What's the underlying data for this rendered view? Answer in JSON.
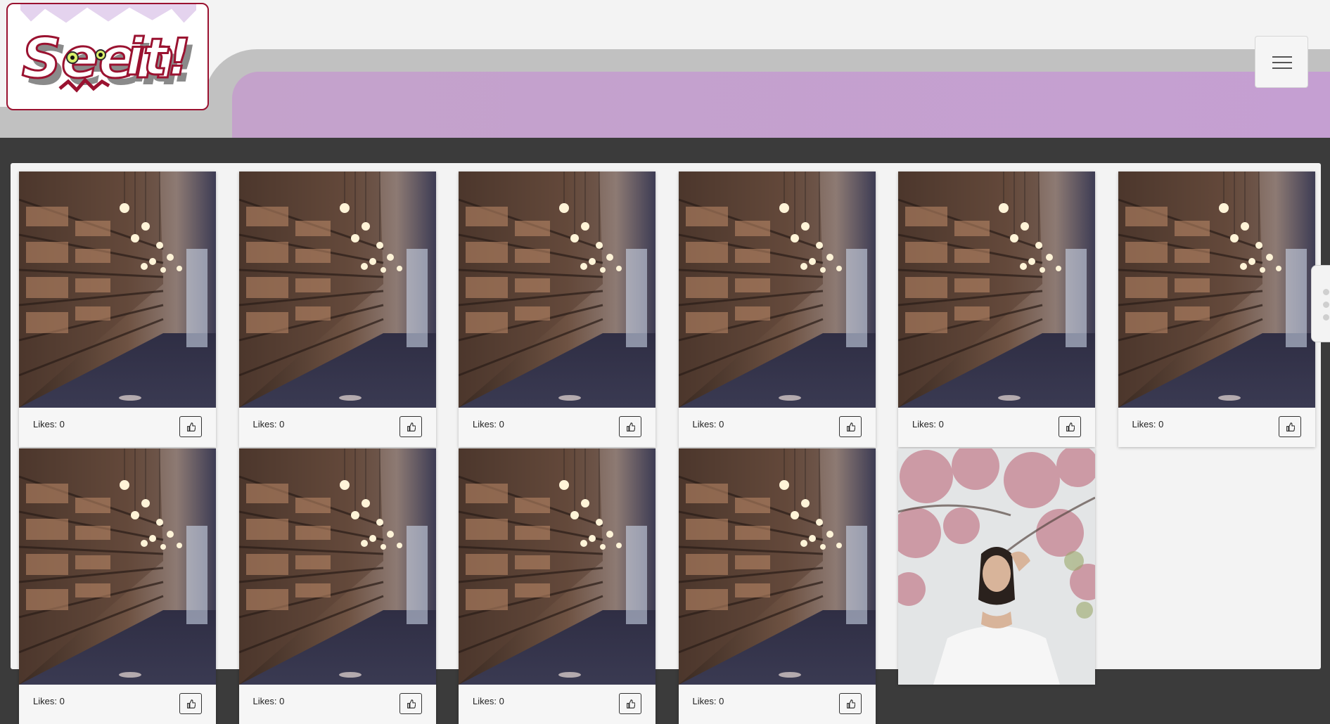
{
  "logo": {
    "text": "Seen it!",
    "icon": "seen-it-logo"
  },
  "header": {
    "menu_icon": "hamburger-menu-icon",
    "colors": {
      "band": "#c1c1c1",
      "accent": "#c59fd2"
    }
  },
  "gallery": {
    "cards": [
      {
        "image": "library-bookshelves",
        "likes_label": "Likes: 0"
      },
      {
        "image": "library-bookshelves",
        "likes_label": "Likes: 0"
      },
      {
        "image": "library-bookshelves",
        "likes_label": "Likes: 0"
      },
      {
        "image": "library-bookshelves",
        "likes_label": "Likes: 0"
      },
      {
        "image": "library-bookshelves",
        "likes_label": "Likes: 0"
      },
      {
        "image": "library-bookshelves",
        "likes_label": "Likes: 0"
      },
      {
        "image": "library-bookshelves",
        "likes_label": "Likes: 0"
      },
      {
        "image": "library-bookshelves",
        "likes_label": "Likes: 0"
      },
      {
        "image": "library-bookshelves",
        "likes_label": "Likes: 0"
      },
      {
        "image": "library-bookshelves",
        "likes_label": "Likes: 0"
      },
      {
        "image": "woman-cherry-blossoms",
        "likes_label": ""
      }
    ],
    "like_icon": "thumbs-up-icon"
  }
}
